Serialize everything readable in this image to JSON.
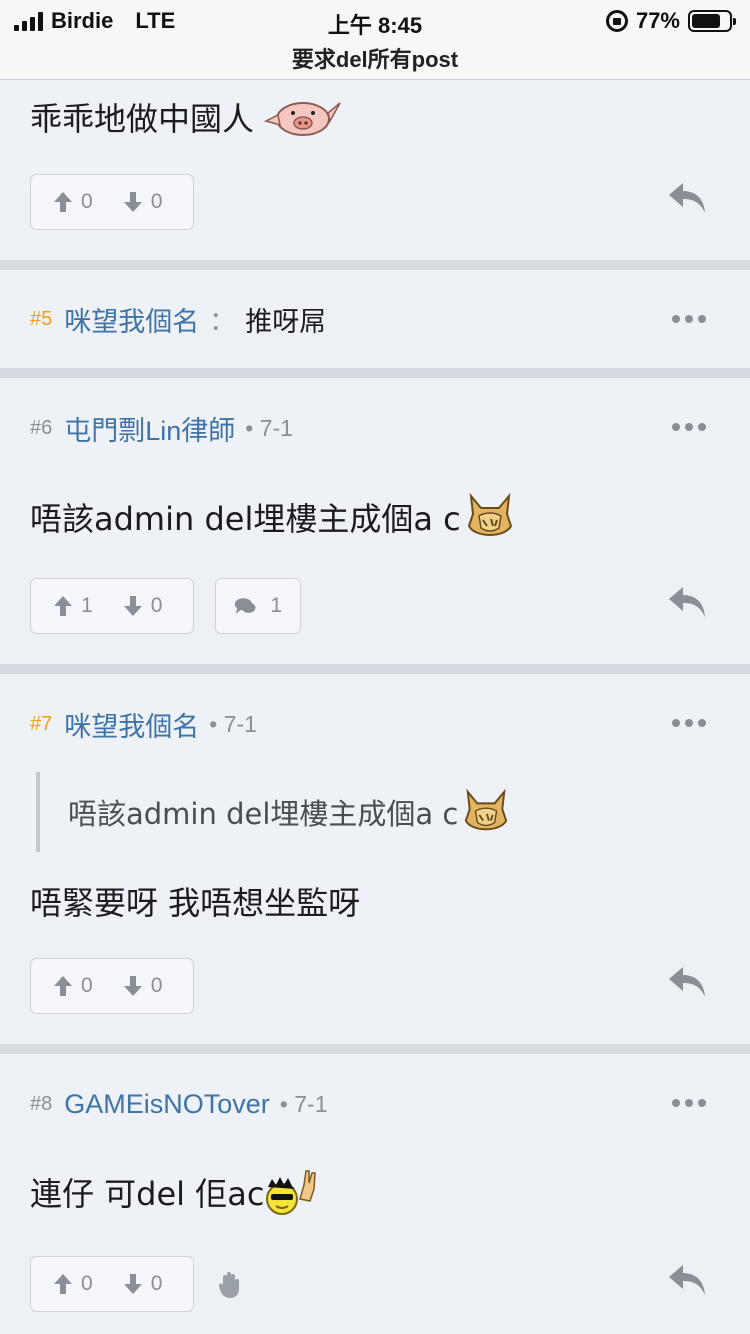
{
  "status_bar": {
    "carrier": "Birdie",
    "network": "LTE",
    "time": "上午 8:45",
    "battery": "77%",
    "battery_level": 0.77
  },
  "nav": {
    "title": "要求del所有post"
  },
  "top_post": {
    "content": "乖乖地做中國人",
    "emoji": "pig-emoji",
    "up": "0",
    "down": "0"
  },
  "posts": [
    {
      "floor": "#5",
      "author": "咪望我個名",
      "colon": "：",
      "inline": "推呀屌"
    },
    {
      "floor": "#6",
      "author": "屯門剽Lin律師",
      "date": "• 7-1",
      "content": "唔該admin del埋樓主成個a c",
      "emoji": "dog-facepalm-emoji",
      "up": "1",
      "down": "0",
      "comments": "1"
    },
    {
      "floor": "#7",
      "author": "咪望我個名",
      "date": "• 7-1",
      "quote": "唔該admin del埋樓主成個a c",
      "content": "唔緊要呀 我唔想坐監呀",
      "up": "0",
      "down": "0"
    },
    {
      "floor": "#8",
      "author": "GAMEisNOTover",
      "date": "• 7-1",
      "content": "連仔 可del 佢ac",
      "emoji": "cool-rock-emoji",
      "up": "0",
      "down": "0"
    }
  ],
  "colors": {
    "author": "#3e74a8",
    "highlight_floor": "#f0a01e",
    "muted": "#8a8f97"
  },
  "icons": [
    "up-arrow-icon",
    "down-arrow-icon",
    "comment-icon",
    "reply-icon",
    "more-icon",
    "hand-icon"
  ]
}
